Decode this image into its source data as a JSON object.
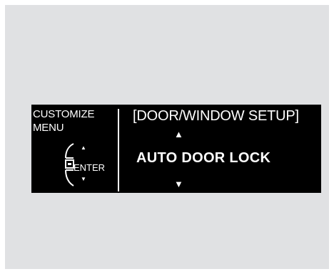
{
  "menu": {
    "label_line1": "CUSTOMIZE",
    "label_line2": "MENU",
    "enter_label": "ENTER",
    "small_up_arrow": "▲",
    "small_down_arrow": "▼"
  },
  "setup": {
    "title": "[DOOR/WINDOW SETUP]",
    "option": "AUTO DOOR LOCK",
    "up_arrow": "▲",
    "down_arrow": "▼"
  },
  "icons": [
    "selector-knob-icon",
    "up-arrow-icon",
    "down-arrow-icon"
  ],
  "colors": {
    "panel_background": "#e0e1e3",
    "screen_background": "#000000",
    "text": "#ffffff"
  }
}
